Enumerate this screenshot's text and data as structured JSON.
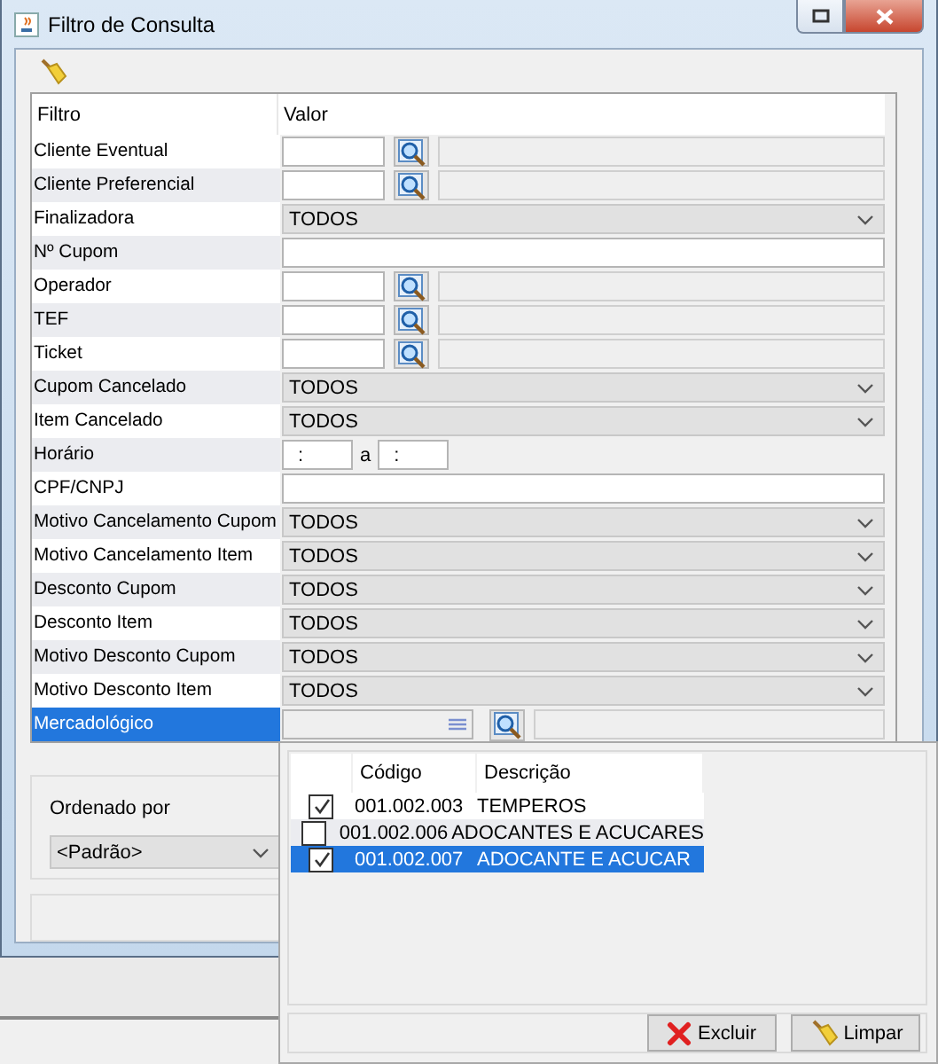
{
  "window": {
    "title": "Filtro de Consulta"
  },
  "table": {
    "columns": [
      "Filtro",
      "Valor"
    ],
    "rows": [
      {
        "label": "Cliente Eventual",
        "kind": "lookup",
        "selected": false
      },
      {
        "label": "Cliente Preferencial",
        "kind": "lookup",
        "selected": false
      },
      {
        "label": "Finalizadora",
        "kind": "combo",
        "value": "TODOS",
        "selected": false
      },
      {
        "label": "Nº Cupom",
        "kind": "text",
        "selected": false
      },
      {
        "label": "Operador",
        "kind": "lookup",
        "selected": false
      },
      {
        "label": "TEF",
        "kind": "lookup",
        "selected": false
      },
      {
        "label": "Ticket",
        "kind": "lookup",
        "selected": false
      },
      {
        "label": "Cupom Cancelado",
        "kind": "combo",
        "value": "TODOS",
        "selected": false
      },
      {
        "label": "Item Cancelado",
        "kind": "combo",
        "value": "TODOS",
        "selected": false
      },
      {
        "label": "Horário",
        "kind": "time",
        "from": ":",
        "separator": "a",
        "to": ":",
        "selected": false
      },
      {
        "label": "CPF/CNPJ",
        "kind": "text",
        "selected": false
      },
      {
        "label": "Motivo Cancelamento Cupom",
        "kind": "combo",
        "value": "TODOS",
        "selected": false
      },
      {
        "label": "Motivo Cancelamento Item",
        "kind": "combo",
        "value": "TODOS",
        "selected": false
      },
      {
        "label": "Desconto Cupom",
        "kind": "combo",
        "value": "TODOS",
        "selected": false
      },
      {
        "label": "Desconto Item",
        "kind": "combo",
        "value": "TODOS",
        "selected": false
      },
      {
        "label": "Motivo Desconto Cupom",
        "kind": "combo",
        "value": "TODOS",
        "selected": false
      },
      {
        "label": "Motivo Desconto Item",
        "kind": "combo",
        "value": "TODOS",
        "selected": false
      },
      {
        "label": "Mercadológico",
        "kind": "multi_lookup",
        "selected": true
      }
    ]
  },
  "order": {
    "label": "Ordenado por",
    "value": "<Padrão>"
  },
  "popup": {
    "columns": [
      "Código",
      "Descrição"
    ],
    "items": [
      {
        "code": "001.002.003",
        "description": "TEMPEROS",
        "checked": true,
        "selected": false
      },
      {
        "code": "001.002.006",
        "description": "ADOCANTES E ACUCARES",
        "checked": false,
        "selected": false
      },
      {
        "code": "001.002.007",
        "description": "ADOCANTE E ACUCAR",
        "checked": true,
        "selected": true
      }
    ],
    "buttons": [
      {
        "label": "Excluir",
        "kind": "delete"
      },
      {
        "label": "Limpar",
        "kind": "clear"
      }
    ]
  }
}
